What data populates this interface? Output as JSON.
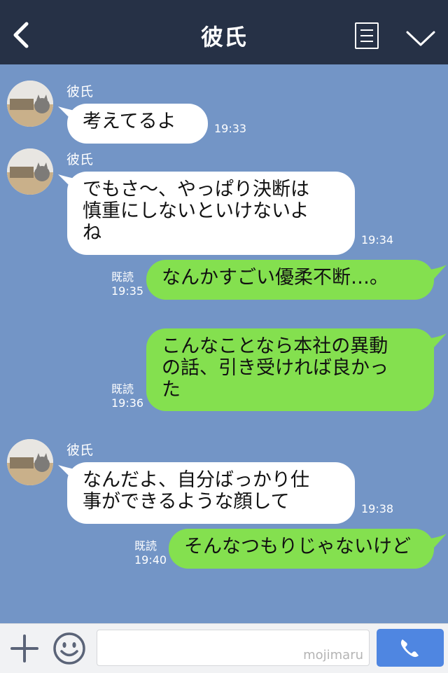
{
  "header": {
    "title": "彼氏",
    "back_icon": "chevron-left-icon",
    "menu_icon": "menu-list-icon",
    "expand_icon": "chevron-down-icon",
    "background": "#263146"
  },
  "chat": {
    "background": "#7395c6",
    "messages": [
      {
        "direction": "in",
        "sender": "彼氏",
        "text": "考えてるよ",
        "time": "19:33"
      },
      {
        "direction": "in",
        "sender": "彼氏",
        "text": "でもさ～、やっぱり決断は\n慎重にしないといけないよ\nね",
        "time": "19:34"
      },
      {
        "direction": "out",
        "read": "既読",
        "text": "なんかすごい優柔不断…。",
        "time": "19:35"
      },
      {
        "direction": "out",
        "read": "既読",
        "text": "こんなことなら本社の異動\nの話、引き受ければ良かっ\nた",
        "time": "19:36"
      },
      {
        "direction": "in",
        "sender": "彼氏",
        "text": "なんだよ、自分ばっかり仕\n事ができるような顔して",
        "time": "19:38"
      },
      {
        "direction": "out",
        "read": "既読",
        "text": "そんなつもりじゃないけど",
        "time": "19:40"
      }
    ],
    "incoming_color": "#ffffff",
    "outgoing_color": "#84e04f"
  },
  "footer": {
    "plus_icon": "plus-icon",
    "sticker_icon": "smiley-icon",
    "input_placeholder": "",
    "watermark": "mojimaru",
    "call_icon": "phone-icon",
    "call_color": "#4f86e1"
  }
}
